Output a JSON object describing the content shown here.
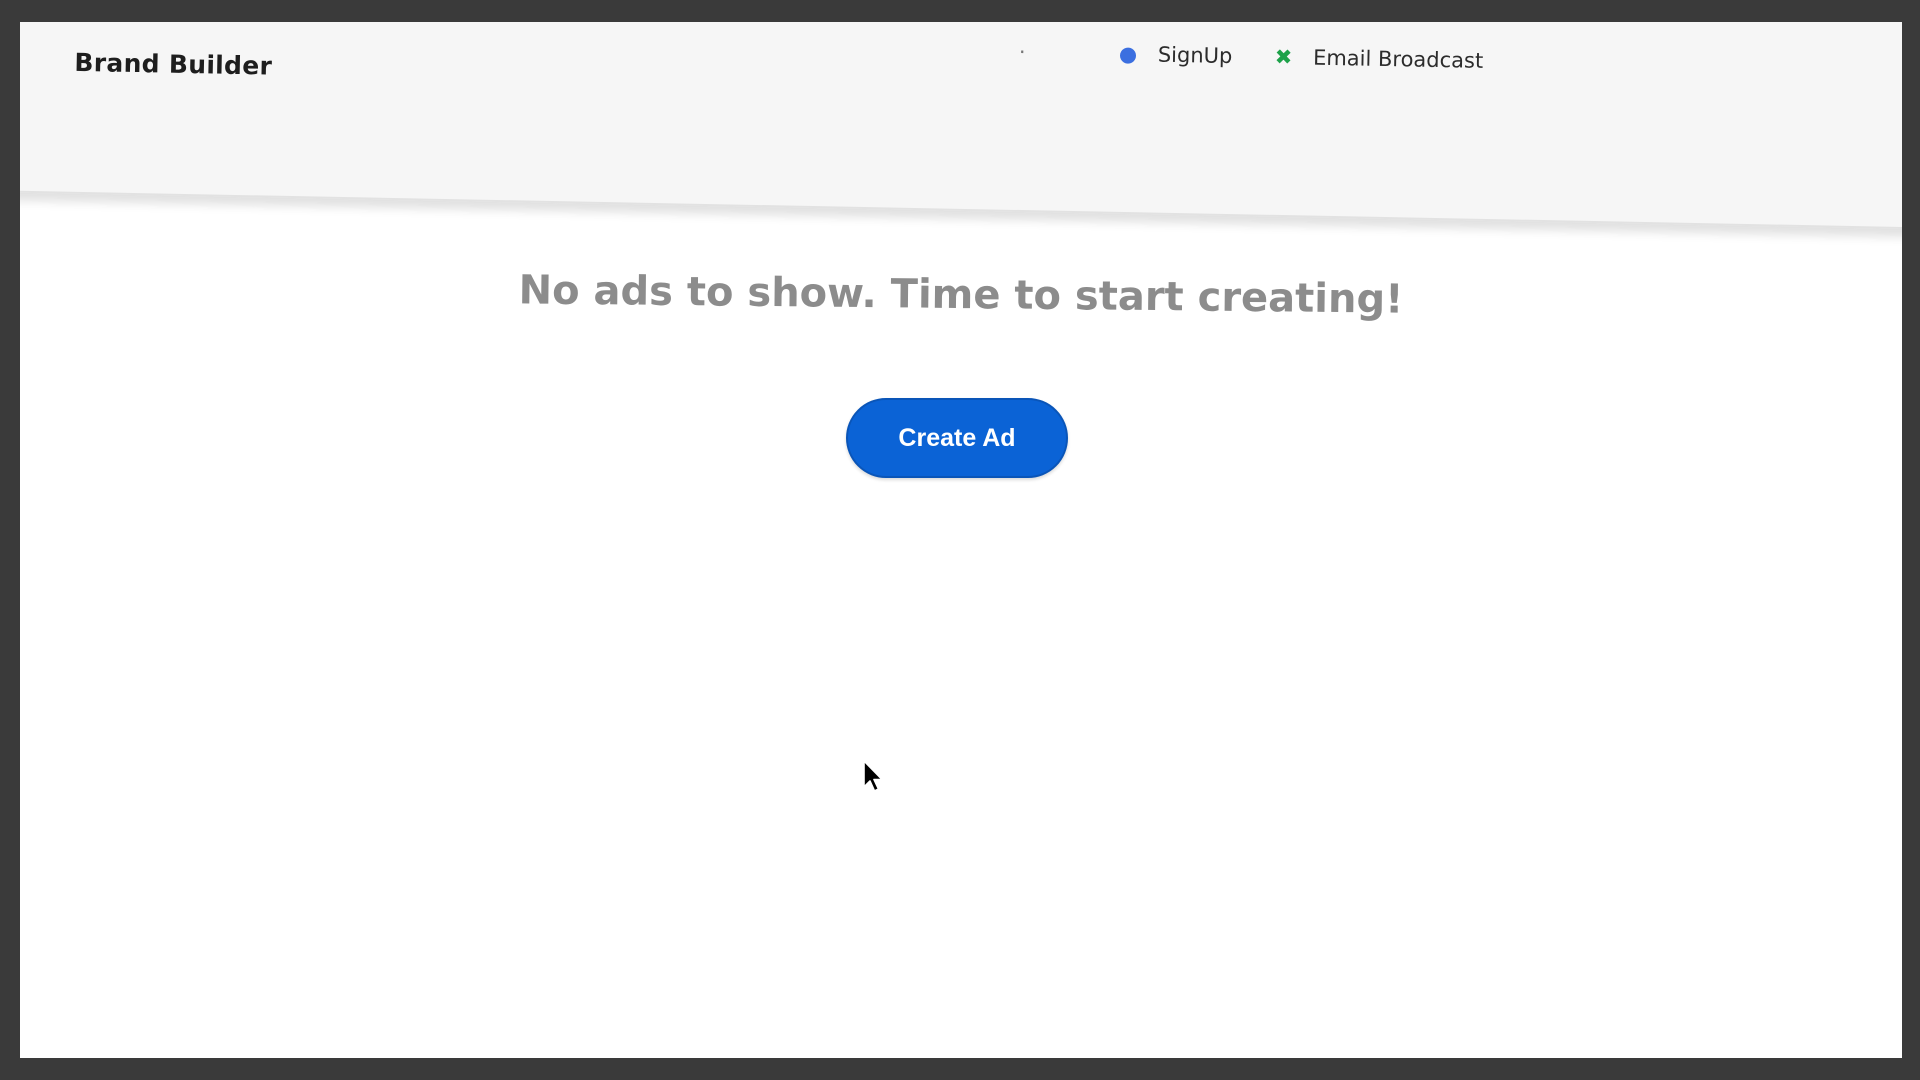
{
  "header": {
    "brand": "Brand Builder",
    "nav": {
      "partial_label": "·",
      "signup_icon": "●",
      "signup_label": "SignUp",
      "email_icon": "✖",
      "email_label": "Email Broadcast"
    }
  },
  "main": {
    "empty_message": "No ads to show. Time to start creating!",
    "create_button_label": "Create Ad"
  },
  "colors": {
    "primary_button": "#0b63d6",
    "message_text": "#8c8c8c",
    "signup_icon": "#3b6fe0",
    "email_icon": "#1ea24a"
  },
  "icons": {
    "signup": "signup-icon",
    "email": "email-broadcast-icon",
    "cursor": "mouse-cursor-icon"
  }
}
